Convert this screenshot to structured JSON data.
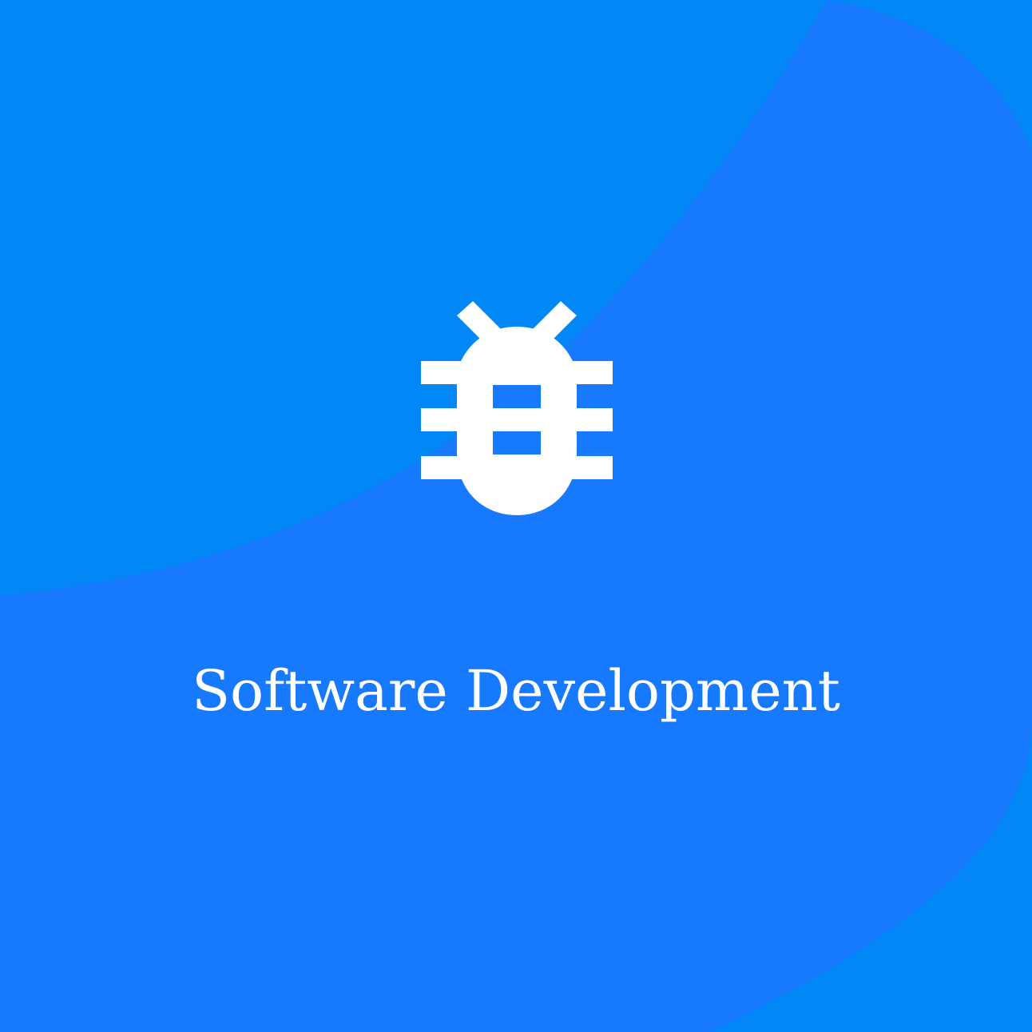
{
  "card": {
    "title": "Software Development",
    "icon": "bug-icon"
  },
  "colors": {
    "base_blue": "#0288F6",
    "blob_blue": "#1779FE",
    "foreground": "#FFFFFF"
  }
}
